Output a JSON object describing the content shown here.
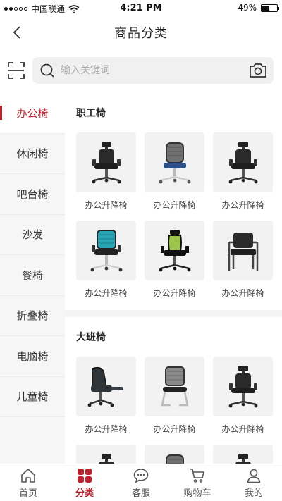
{
  "status_bar": {
    "carrier": "中国联通",
    "time": "4:21 PM",
    "battery": "49%",
    "battery_level": 0.49
  },
  "nav": {
    "title": "商品分类"
  },
  "search": {
    "placeholder": "输入关键词"
  },
  "sidebar": {
    "items": [
      {
        "label": "办公椅",
        "active": true
      },
      {
        "label": "休闲椅"
      },
      {
        "label": "吧台椅"
      },
      {
        "label": "沙发"
      },
      {
        "label": "餐椅"
      },
      {
        "label": "折叠椅"
      },
      {
        "label": "电脑椅"
      },
      {
        "label": "儿童椅"
      }
    ]
  },
  "sections": [
    {
      "title": "职工椅",
      "products": [
        {
          "name": "办公升降椅",
          "image": "black-mesh-highback-chair"
        },
        {
          "name": "办公升降椅",
          "image": "grey-mesh-chair"
        },
        {
          "name": "办公升降椅",
          "image": "black-mesh-highback-chair"
        },
        {
          "name": "办公升降椅",
          "image": "teal-mesh-chair"
        },
        {
          "name": "办公升降椅",
          "image": "green-gaming-chair"
        },
        {
          "name": "办公升降椅",
          "image": "black-visitor-chair"
        }
      ]
    },
    {
      "title": "大班椅",
      "products": [
        {
          "name": "办公升降椅",
          "image": "black-leather-recliner"
        },
        {
          "name": "办公升降椅",
          "image": "grey-mesh-sled-chair"
        },
        {
          "name": "办公升降椅",
          "image": "black-mesh-highback-chair"
        },
        {
          "name": "",
          "image": "black-mesh-highback-chair"
        },
        {
          "name": "",
          "image": "grey-mesh-chair"
        },
        {
          "name": "",
          "image": "black-mesh-highback-chair"
        }
      ]
    }
  ],
  "tabs": [
    {
      "label": "首页",
      "icon": "home-icon"
    },
    {
      "label": "分类",
      "icon": "category-icon",
      "active": true
    },
    {
      "label": "客服",
      "icon": "chat-icon"
    },
    {
      "label": "购物车",
      "icon": "cart-icon"
    },
    {
      "label": "我的",
      "icon": "user-icon"
    }
  ],
  "colors": {
    "accent": "#b8232f",
    "sidebar_bg": "#f6f6f6",
    "card_bg": "#f2f2f2"
  }
}
